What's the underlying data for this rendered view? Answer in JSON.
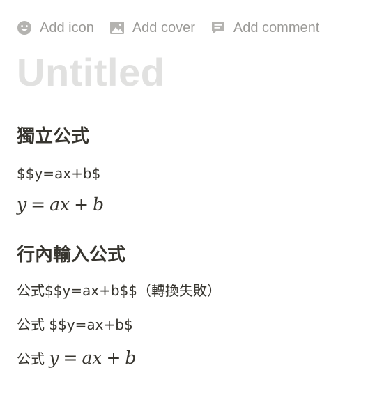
{
  "toolbar": {
    "add_icon_label": "Add icon",
    "add_cover_label": "Add cover",
    "add_comment_label": "Add comment"
  },
  "page_title": "Untitled",
  "sections": [
    {
      "heading": "獨立公式",
      "raw_text": "$$y=ax+b$",
      "math": {
        "lhs": "y",
        "equals": "=",
        "term1": "ax",
        "plus": "+",
        "term2": "b"
      }
    },
    {
      "heading": "行內輸入公式",
      "line1": "公式$$y=ax+b$$（轉換失敗）",
      "line2": "公式 $$y=ax+b$",
      "line3_prefix": "公式",
      "math": {
        "lhs": "y",
        "equals": "=",
        "term1": "ax",
        "plus": "+",
        "term2": "b"
      }
    }
  ],
  "colors": {
    "toolbar_text": "#9b9a97",
    "title_placeholder": "#e1e1e0",
    "body_text": "#37352f"
  }
}
